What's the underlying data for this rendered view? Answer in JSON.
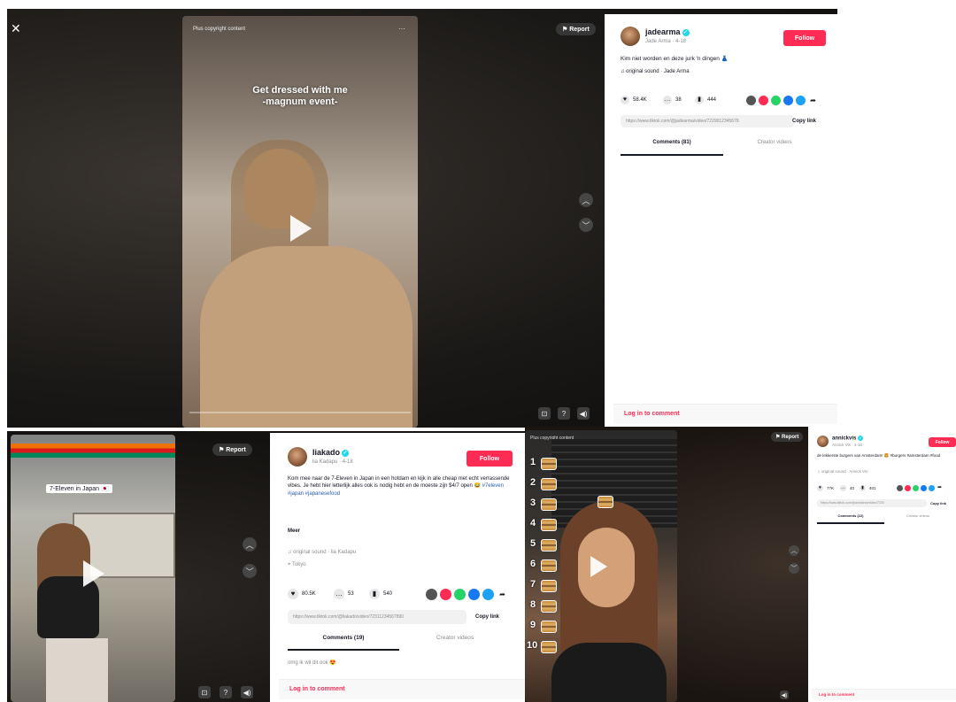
{
  "colors": {
    "accent": "#fe2c55",
    "link": "#2b5db9",
    "text": "#161823",
    "muted": "#8a8b91"
  },
  "panel1": {
    "close_label": "✕",
    "report_label": "Report",
    "video_top_text": "Plus copyright content",
    "overlay_text_line1": "Get dressed with me",
    "overlay_text_line2": "-magnum event-",
    "username": "jadearma",
    "sub": "Jade Arma · 4-18",
    "follow_label": "Follow",
    "description": "Kim niet worden en deze jurk 'n dingen 👗",
    "music": "original sound · Jade Arma",
    "likes": "58.4K",
    "comments": "38",
    "saves": "444",
    "link_text": "https://www.tiktok.com/@jadearma/video/7229012345678",
    "copy_label": "Copy link",
    "tab_comments": "Comments (81)",
    "tab_creator": "Creator videos",
    "login_text": "Log in to comment"
  },
  "panel2": {
    "report_label": "Report",
    "overlay_tag": "7-Eleven in Japan 🇯🇵",
    "username": "liakado",
    "sub": "lia Kadapu · 4-18",
    "follow_label": "Follow",
    "description": "Kom mee naar de 7-Eleven in Japan in een hotdam en kijk in alle cheap met echt verrassende vibes. Je hebt hier letterlijk alles ook is nodig hebt en de moeste zijn $4/7 open 😂",
    "hashtags": "#7eleven #japan #japanesefood",
    "more_label": "Meer",
    "music": "original sound · lia Kadapu",
    "location": "Tokyo",
    "likes": "80.5K",
    "comments": "53",
    "saves": "540",
    "link_text": "https://www.tiktok.com/@liakado/video/72311234567890",
    "copy_label": "Copy link",
    "tab_comments": "Comments (19)",
    "tab_creator": "Creator videos",
    "comment_preview": "omg ik wil dit ook 😍",
    "login_text": "Log in to comment"
  },
  "panel3": {
    "report_label": "Report",
    "video_top_text": "Plus copyright content",
    "ranks": [
      "1",
      "2",
      "3",
      "4",
      "5",
      "6",
      "7",
      "8",
      "9",
      "10"
    ],
    "username": "annickvis",
    "sub": "Annick Vis · 4-18",
    "follow_label": "Follow",
    "description": "de lekkerste burgers van Amsterdam! 🍔 #burgers #amsterdam #food",
    "music": "original sound · Annick Vis",
    "likes": "77K",
    "comments": "40",
    "saves": "401",
    "link_text": "https://www.tiktok.com/@annickvis/video/7230",
    "copy_label": "Copy link",
    "tab_comments": "Comments (22)",
    "tab_creator": "Creator videos",
    "login_text": "Log in to comment"
  }
}
